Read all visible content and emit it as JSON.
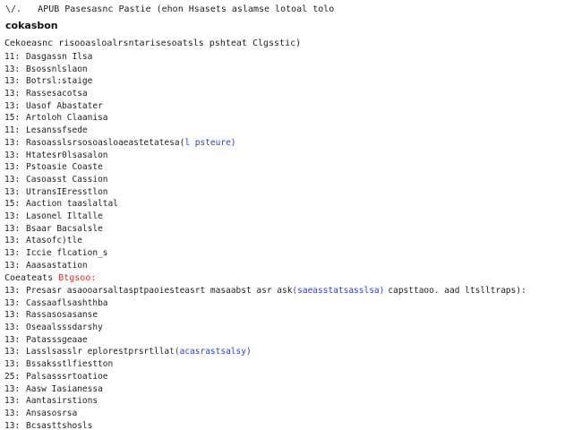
{
  "header": {
    "version_mark": "\\/.",
    "line": "APUB Pasesasnc Pastie (ehon Hsasets aslamse lotoal tolo"
  },
  "title": "cokasbon",
  "section1": {
    "heading": "Cekoeasnc risooasloalrsntarisesoatsls pshteat Clgsstic)",
    "items": [
      {
        "num": "11:",
        "text": "Dasgassn Ilsa"
      },
      {
        "num": "13:",
        "text": "Bsossnlslaon"
      },
      {
        "num": "13:",
        "text": "Botrsl:staige"
      },
      {
        "num": "13:",
        "text": "Rassesacotsa"
      },
      {
        "num": "13:",
        "text": "Uasof Abastater"
      },
      {
        "num": "15:",
        "text": "Artoloh Claanisa"
      },
      {
        "num": "11:",
        "text": "Lesanssfsede"
      },
      {
        "num": "13:",
        "text": "Rasoasslsrsosoasloaeastetatesa(",
        "link": "l psteure)"
      },
      {
        "num": "13:",
        "text": "Htatesr0lsasalon"
      },
      {
        "num": "13:",
        "text": "Pstoasie Coaste"
      },
      {
        "num": "13:",
        "text": "Casoasst Cassion"
      },
      {
        "num": "13:",
        "text": "UtransIEresstlon"
      },
      {
        "num": "15:",
        "text": "Aaction taaslaltal"
      },
      {
        "num": "13:",
        "text": "Lasonel Iltalle"
      },
      {
        "num": "13:",
        "text": "Bsaar Bacsalsle"
      },
      {
        "num": "13:",
        "text": "Atasofc)tle"
      },
      {
        "num": "13:",
        "text": "Iccie flcation_s"
      },
      {
        "num": "13:",
        "text": "Aaasastation"
      }
    ]
  },
  "section2": {
    "heading": "Coeateats",
    "heading_warn": "Btgsoo:",
    "items": [
      {
        "num": "13:",
        "text": "Presasr asaooarsaltasptpaoiesteasrt masaabst asr ask",
        "link": "(saeasstatsasslsa)",
        "tail": "capsttaoo. aad ltslltraps):"
      },
      {
        "num": "13:",
        "text": "Cassaaflsashthba"
      },
      {
        "num": "13:",
        "text": "Rassasosasanse"
      },
      {
        "num": "13:",
        "text": "Oseaalsssdarshy"
      },
      {
        "num": "13:",
        "text": "Patasssgeaae"
      },
      {
        "num": "13:",
        "text": "Lasslsasslr eplorestprsrtlla",
        "link": "t(acasrastsalsy)"
      },
      {
        "num": "13:",
        "text": "Bssaksstlfiestton"
      },
      {
        "num": "25:",
        "text": "Palsasssrtoatioe"
      },
      {
        "num": "13:",
        "text": "Aasw Iasianessa"
      },
      {
        "num": "13:",
        "text": "Aantasirstions"
      },
      {
        "num": "13:",
        "text": "Ansasosrsa"
      },
      {
        "num": "13:",
        "text": "Bcsasttshosls"
      }
    ]
  }
}
